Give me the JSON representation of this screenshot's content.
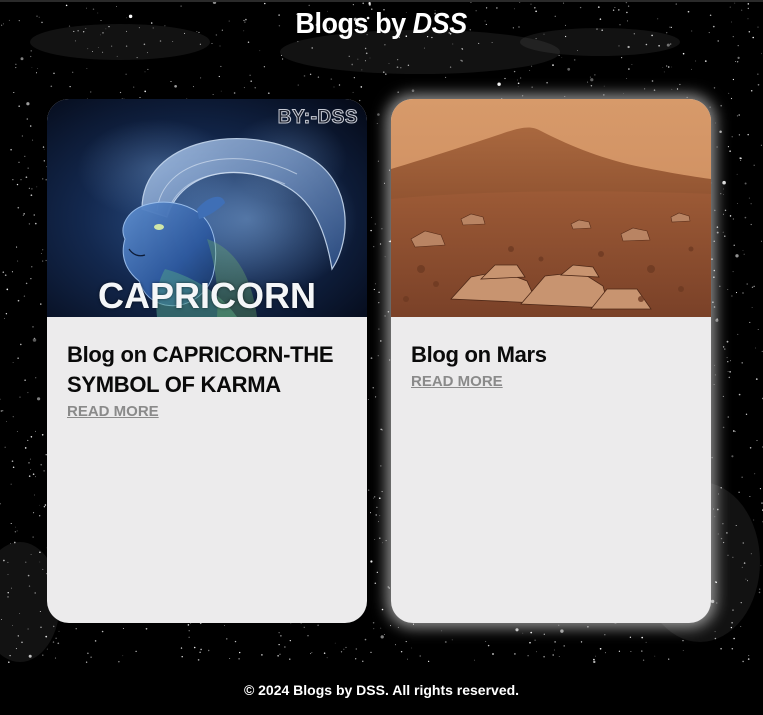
{
  "header": {
    "title_prefix": "Blogs by",
    "title_brand": "DSS"
  },
  "posts": [
    {
      "title": "Blog on CAPRICORN-THE SYMBOL OF KARMA",
      "link_label": "READ MORE",
      "image": {
        "overlay_word": "CAPRICORN",
        "watermark": "BY:-DSS"
      }
    },
    {
      "title": "Blog on Mars",
      "link_label": "READ MORE",
      "image": {}
    }
  ],
  "footer": {
    "text": "© 2024 Blogs by DSS. All rights reserved."
  },
  "colors": {
    "page_background": "#000000",
    "card_background": "#ecebec",
    "link_color": "#8a8a8a",
    "title_color": "#0a0a0a",
    "header_text": "#ffffff"
  }
}
